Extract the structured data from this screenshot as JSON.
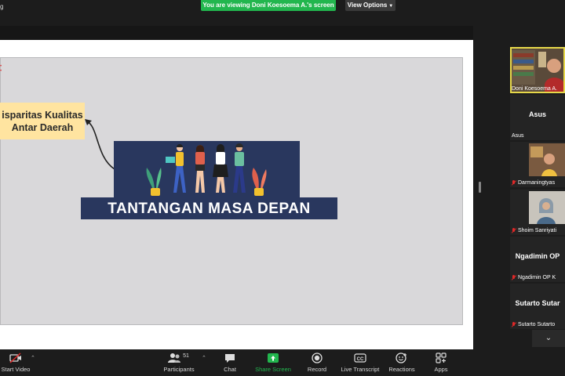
{
  "topbar": {
    "left_text": "g",
    "viewing_banner": "You are viewing Doni Koesoema A.'s screen",
    "view_options": "View Options"
  },
  "slide": {
    "callout_line1": "isparitas Kualitas",
    "callout_line2": "Antar Daerah",
    "banner_title": "TANTANGAN MASA DEPAN"
  },
  "participants": [
    {
      "name": "Doni Koesoema A.",
      "video": true,
      "active": true,
      "muted": false
    },
    {
      "name": "Asus",
      "video": false,
      "muted": false
    },
    {
      "name": "Darmaningtyas",
      "video": true,
      "muted": true
    },
    {
      "name": "Shoim Sanriyati",
      "video": true,
      "muted": true
    },
    {
      "name": "Ngadimin OP",
      "label": "Ngadimin OP K",
      "video": false,
      "muted": true
    },
    {
      "name": "Sutarto Sutar",
      "label": "Sutarto Sutarto",
      "video": false,
      "muted": true
    }
  ],
  "toolbar": {
    "start_video": "Start Video",
    "participants": "Participants",
    "participants_count": "51",
    "chat": "Chat",
    "share_screen": "Share Screen",
    "record": "Record",
    "live_transcript": "Live Transcript",
    "reactions": "Reactions",
    "apps": "Apps",
    "cc": "CC"
  },
  "colors": {
    "share_green": "#22b64e",
    "banner_navy": "#29375e",
    "callout_yellow": "#ffe4a0",
    "active_speaker": "#e6d84a",
    "muted_red": "#e02828"
  }
}
